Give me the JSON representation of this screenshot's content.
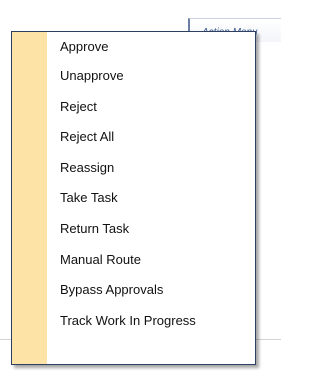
{
  "action_menu": {
    "label": "Action Menu"
  },
  "menu": {
    "items": [
      {
        "label": "Approve"
      },
      {
        "label": "Unapprove"
      },
      {
        "label": "Reject"
      },
      {
        "label": "Reject All"
      },
      {
        "label": "Reassign"
      },
      {
        "label": "Take Task"
      },
      {
        "label": "Return Task"
      },
      {
        "label": "Manual Route"
      },
      {
        "label": "Bypass Approvals"
      },
      {
        "label": "Track Work In Progress"
      }
    ]
  }
}
